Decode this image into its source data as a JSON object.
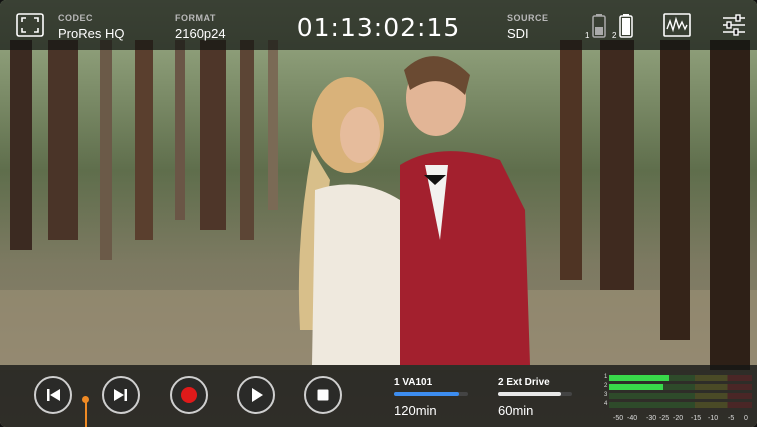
{
  "topbar": {
    "codec_label": "CODEC",
    "codec_value": "ProRes HQ",
    "format_label": "FORMAT",
    "format_value": "2160p24",
    "timecode": "01:13:02:15",
    "source_label": "SOURCE",
    "source_value": "SDI",
    "battery_1": "1",
    "battery_2": "2",
    "icons": [
      "fullscreen-icon",
      "battery-icon",
      "waveform-icon",
      "settings-sliders-icon"
    ]
  },
  "transport": {
    "buttons": [
      "skip-back-icon",
      "skip-forward-icon",
      "record-icon",
      "play-icon",
      "stop-icon"
    ]
  },
  "storage": {
    "slot1": {
      "name": "1  VA101",
      "time": "120min",
      "fill": 0.88,
      "color": "#3d8df0"
    },
    "slot2": {
      "name": "2  Ext Drive",
      "time": "60min",
      "fill": 0.85,
      "color": "#e8e8e8"
    }
  },
  "audio_meter": {
    "channels": [
      "1",
      "2",
      "3",
      "4"
    ],
    "scale": [
      "-50",
      "-40",
      "-30",
      "-25",
      "-20",
      "-15",
      "-10",
      "-5",
      "0"
    ],
    "levels": [
      0.42,
      0.38,
      0.0,
      0.0
    ]
  },
  "colors": {
    "accent": "#f08a24",
    "record": "#e01a1a"
  }
}
